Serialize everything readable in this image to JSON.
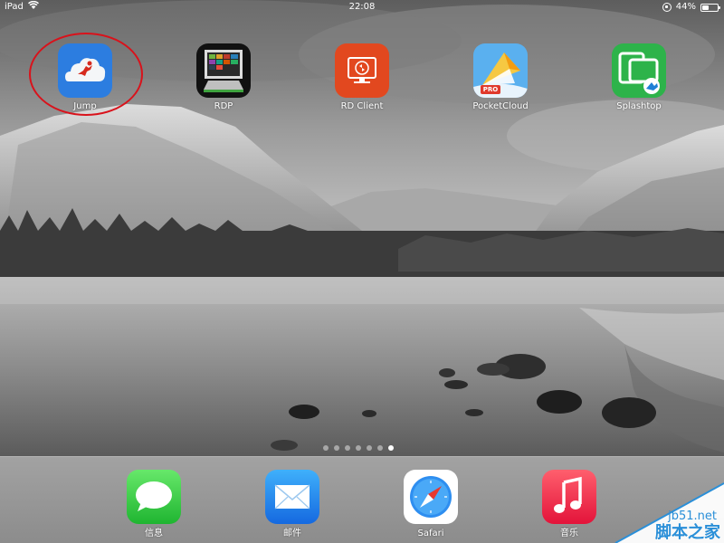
{
  "status_bar": {
    "device": "iPad",
    "time": "22:08",
    "battery_percent": "44%",
    "battery_level": 0.44
  },
  "apps": [
    {
      "name": "Jump",
      "icon": "jump-cloud-icon",
      "highlighted": true
    },
    {
      "name": "RDP",
      "icon": "rdp-monitor-icon"
    },
    {
      "name": "RD Client",
      "icon": "rd-client-icon"
    },
    {
      "name": "PocketCloud",
      "icon": "pocketcloud-icon",
      "badge": "PRO"
    },
    {
      "name": "Splashtop",
      "icon": "splashtop-icon"
    }
  ],
  "page_indicator": {
    "count": 7,
    "active_index": 6
  },
  "dock": [
    {
      "name": "信息",
      "icon": "messages-icon"
    },
    {
      "name": "邮件",
      "icon": "mail-icon"
    },
    {
      "name": "Safari",
      "icon": "safari-icon"
    },
    {
      "name": "音乐",
      "icon": "music-icon"
    }
  ],
  "watermark": {
    "site": "jb51.net",
    "title": "脚本之家"
  },
  "colors": {
    "highlight_ring": "#d9121b",
    "jump_bg": "#2c7de0",
    "rd_client_bg": "#e2481f",
    "splashtop_bg": "#2db34a",
    "messages_bg": "#3fcf4a",
    "mail_bg": "#1d8cf0",
    "music_bg": "#f5344d"
  }
}
